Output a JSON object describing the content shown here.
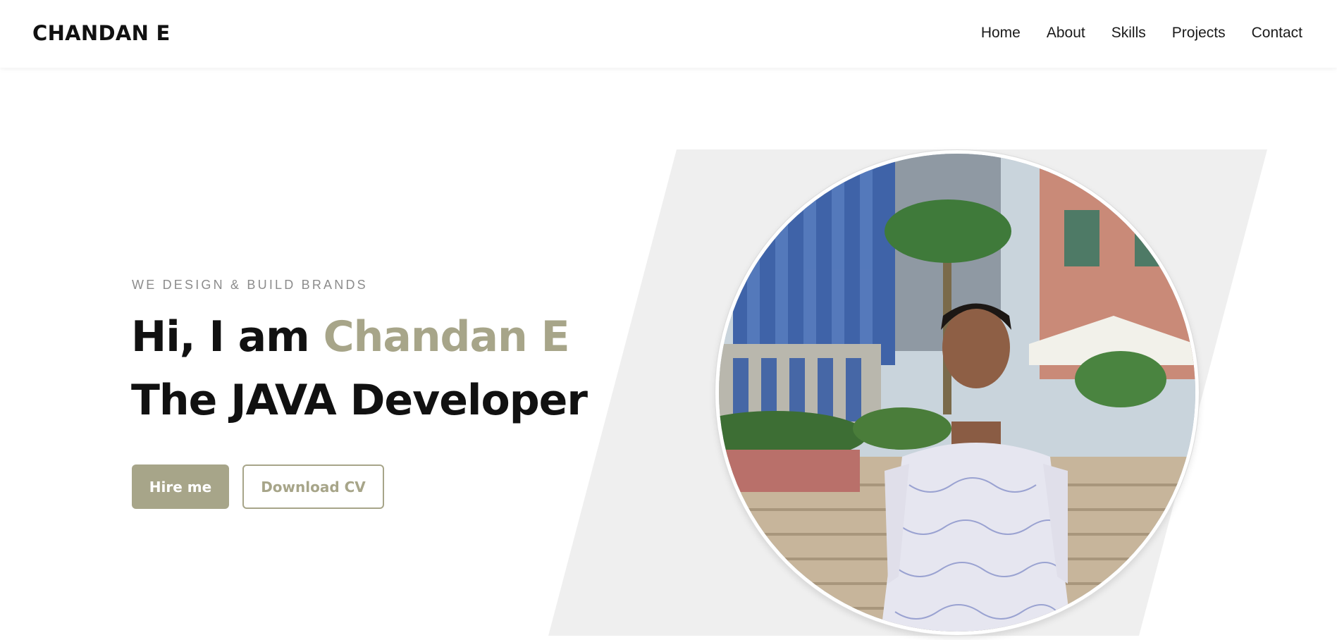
{
  "header": {
    "brand": "CHANDAN E",
    "nav": [
      "Home",
      "About",
      "Skills",
      "Projects",
      "Contact"
    ]
  },
  "hero": {
    "tagline": "WE DESIGN & BUILD BRANDS",
    "greeting": "Hi, I am",
    "name": "Chandan E",
    "role": "The JAVA Developer",
    "primary_button": "Hire me",
    "secondary_button": "Download CV",
    "photo_alt": "Chandan E"
  },
  "colors": {
    "accent": "#a7a589",
    "panel": "#efefef",
    "text": "#111111",
    "muted": "#8c8c8c"
  }
}
